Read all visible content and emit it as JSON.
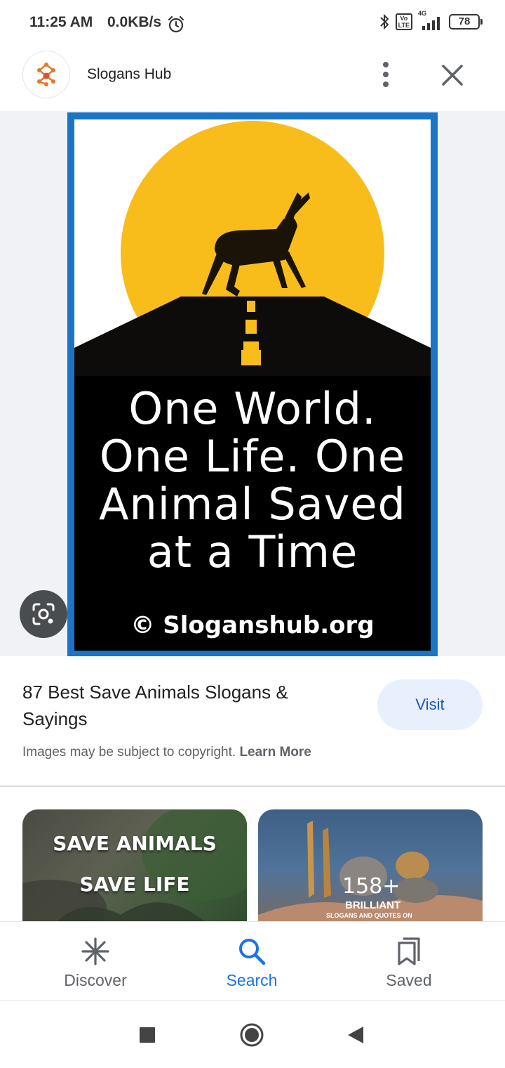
{
  "status_bar": {
    "time": "11:25 AM",
    "network_speed": "0.0KB/s",
    "network_type": "4G",
    "volte_line1": "Vo",
    "volte_line2": "LTE",
    "battery": "78",
    "icons": [
      "alarm-icon",
      "bluetooth-icon",
      "volte-icon",
      "signal-icon",
      "battery-icon"
    ]
  },
  "header": {
    "site_name": "Slogans Hub",
    "icons": [
      "site-logo-icon",
      "more-vert-icon",
      "close-icon"
    ]
  },
  "image": {
    "slogan_lines": [
      "One World.",
      "One Life. One",
      "Animal Saved",
      "at a Time"
    ],
    "watermark": "© Sloganshub.org",
    "colors": {
      "frame": "#1a74c8",
      "sun": "#f8bd1a",
      "ground": "#000000"
    }
  },
  "result": {
    "title": "87 Best Save Animals Slogans & Sayings",
    "visit_label": "Visit",
    "copyright_text": "Images may be subject to copyright.",
    "learn_more_label": "Learn More"
  },
  "related": {
    "left_card": {
      "line1": "SAVE ANIMALS",
      "line2": "SAVE LIFE"
    },
    "right_card": {
      "number": "158+",
      "line1": "BRILLIANT",
      "line2": "SLOGANS AND QUOTES ON"
    }
  },
  "bottom_nav": {
    "items": [
      {
        "label": "Discover",
        "icon": "discover-icon"
      },
      {
        "label": "Search",
        "icon": "search-icon",
        "active": true
      },
      {
        "label": "Saved",
        "icon": "saved-icon"
      }
    ],
    "active_color": "#1a73e8"
  },
  "system_nav": {
    "icons": [
      "recents-icon",
      "home-icon",
      "back-icon"
    ]
  }
}
